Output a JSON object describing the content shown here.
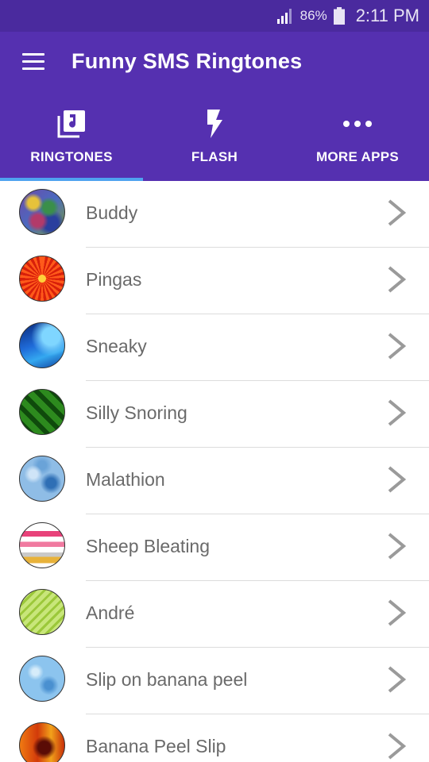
{
  "status_bar": {
    "battery_percent": "86%",
    "time": "2:11 PM"
  },
  "app_bar": {
    "title": "Funny SMS Ringtones",
    "menu_icon": "hamburger-menu-icon"
  },
  "tabs": [
    {
      "label": "RINGTONES",
      "icon": "music-library-icon",
      "selected": true
    },
    {
      "label": "FLASH",
      "icon": "flash-icon",
      "selected": false
    },
    {
      "label": "MORE APPS",
      "icon": "more-dots-icon",
      "selected": false
    }
  ],
  "ringtones": [
    {
      "label": "Buddy",
      "thumb": "t-buddy"
    },
    {
      "label": "Pingas",
      "thumb": "t-pingas"
    },
    {
      "label": "Sneaky",
      "thumb": "t-sneaky"
    },
    {
      "label": "Silly Snoring",
      "thumb": "t-snoring"
    },
    {
      "label": "Malathion",
      "thumb": "t-malathion"
    },
    {
      "label": "Sheep Bleating",
      "thumb": "t-sheep"
    },
    {
      "label": "André",
      "thumb": "t-andre"
    },
    {
      "label": "Slip on banana peel",
      "thumb": "t-slip"
    },
    {
      "label": "Banana Peel Slip",
      "thumb": "t-banana"
    }
  ],
  "colors": {
    "status_bar": "#4a2a9e",
    "app_bar": "#5530b0",
    "tab_indicator": "#4fa3ef",
    "row_text": "#6a6a6a",
    "chevron": "#9a9a9a"
  }
}
